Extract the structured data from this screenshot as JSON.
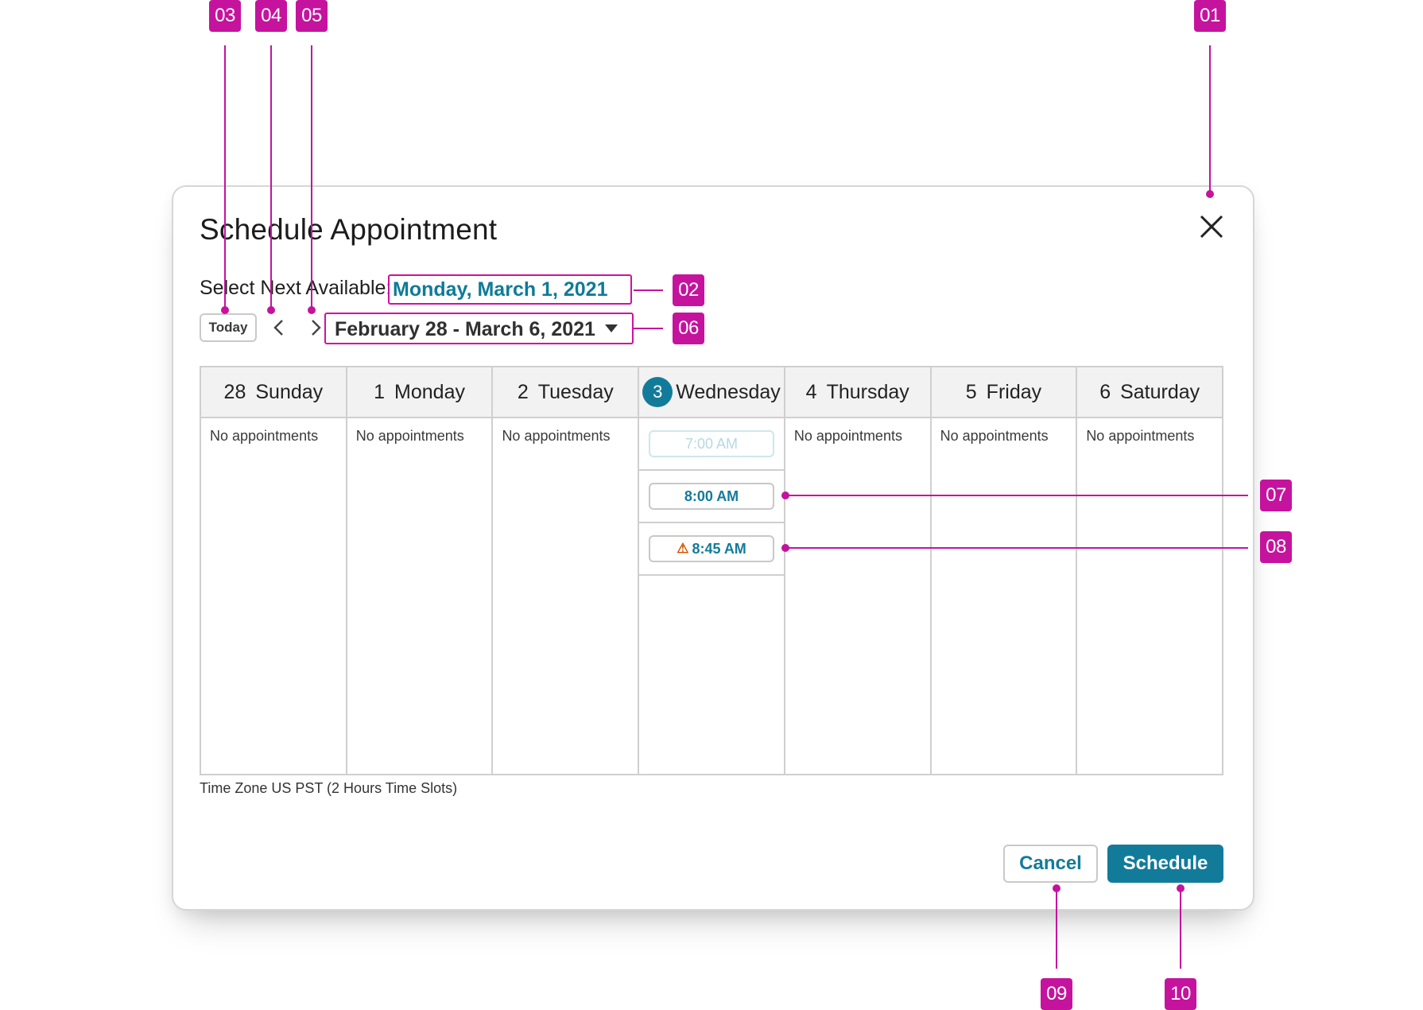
{
  "dialog": {
    "title": "Schedule Appointment",
    "close_icon": "close-icon",
    "next_available_label": "Select Next Available:",
    "next_available_value": "Monday, March 1, 2021",
    "today_label": "Today",
    "prev_icon": "chevron-left-icon",
    "next_icon": "chevron-right-icon",
    "date_range": "February 28 - March 6, 2021",
    "days": [
      {
        "num": "28",
        "name": "Sunday",
        "empty": "No appointments"
      },
      {
        "num": "1",
        "name": "Monday",
        "empty": "No appointments"
      },
      {
        "num": "2",
        "name": "Tuesday",
        "empty": "No appointments"
      },
      {
        "num": "3",
        "name": "Wednesday"
      },
      {
        "num": "4",
        "name": "Thursday",
        "empty": "No appointments"
      },
      {
        "num": "5",
        "name": "Friday",
        "empty": "No appointments"
      },
      {
        "num": "6",
        "name": "Saturday",
        "empty": "No appointments"
      }
    ],
    "slots": [
      "7:00 AM",
      "8:00 AM",
      "8:45 AM"
    ],
    "warning_icon": "warning-icon",
    "timezone_note": "Time Zone US PST (2 Hours Time Slots)",
    "cancel_label": "Cancel",
    "schedule_label": "Schedule"
  },
  "annotations": [
    "01",
    "02",
    "03",
    "04",
    "05",
    "06",
    "07",
    "08",
    "09",
    "10"
  ],
  "colors": {
    "accent": "#137b9a",
    "annotation": "#c5139e",
    "warning": "#d35400"
  }
}
